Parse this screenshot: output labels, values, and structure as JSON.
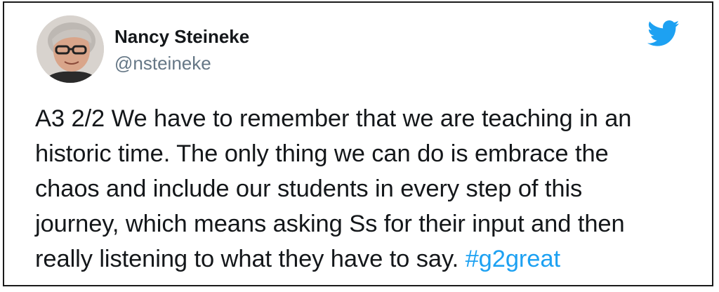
{
  "tweet": {
    "author": {
      "display_name": "Nancy Steineke",
      "handle": "@nsteineke"
    },
    "text_lines": [
      "A3 2/2 We have to remember that we are teaching in an",
      "historic time. The only thing we can do is embrace the",
      "chaos and include our students in every step of this",
      "journey, which means asking Ss for their input and then",
      "really listening to what they have to say. "
    ],
    "hashtag": "#g2great",
    "icons": {
      "brand": "twitter-bird-icon",
      "avatar": "profile-photo"
    },
    "colors": {
      "brand_blue": "#1da1f2",
      "text": "#14171a",
      "handle_gray": "#657786",
      "border": "#1a1a1a"
    }
  }
}
